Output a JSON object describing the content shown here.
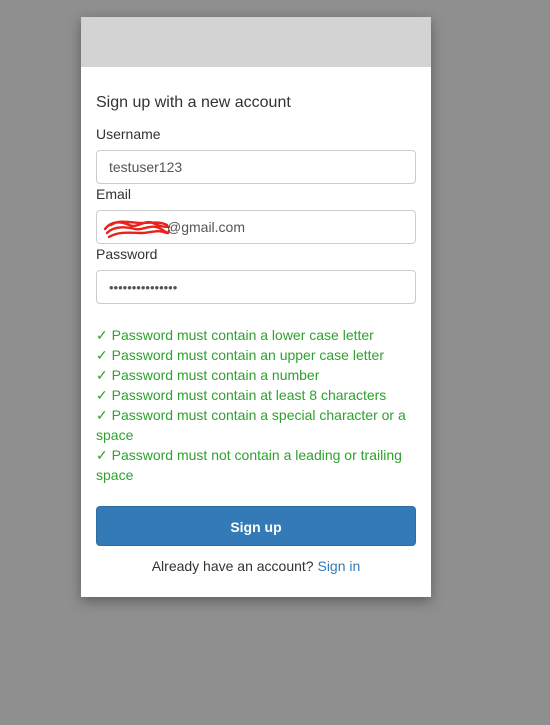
{
  "form": {
    "title": "Sign up with a new account",
    "username": {
      "label": "Username",
      "value": "testuser123"
    },
    "email": {
      "label": "Email",
      "value": "@gmail.com",
      "redaction_color": "#e8231c"
    },
    "password": {
      "label": "Password",
      "value": "•••••••••••••••"
    },
    "rules": [
      "✓ Password must contain a lower case letter",
      "✓ Password must contain an upper case letter",
      "✓ Password must contain a number",
      "✓ Password must contain at least 8 characters",
      "✓ Password must contain a special character or a space",
      "✓ Password must not contain a leading or trailing space"
    ],
    "submit_label": "Sign up",
    "signin_prompt": "Already have an account?",
    "signin_link": "Sign in"
  },
  "colors": {
    "backdrop": "#8f8f8f",
    "header": "#d3d3d3",
    "primary": "#337ab7",
    "rule_valid": "#2fa12f"
  }
}
